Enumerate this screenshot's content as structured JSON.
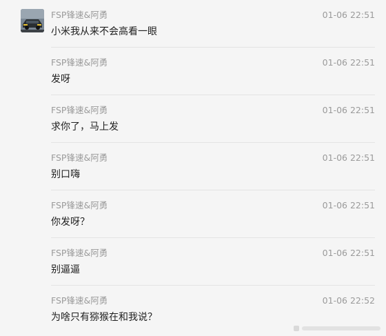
{
  "messages": [
    {
      "sender": "FSP锋速&阿勇",
      "time": "01-06 22:51",
      "text": "小米我从来不会高看一眼",
      "has_avatar": true
    },
    {
      "sender": "FSP锋速&阿勇",
      "time": "01-06 22:51",
      "text": "发呀",
      "has_avatar": false
    },
    {
      "sender": "FSP锋速&阿勇",
      "time": "01-06 22:51",
      "text": "求你了，马上发",
      "has_avatar": false
    },
    {
      "sender": "FSP锋速&阿勇",
      "time": "01-06 22:51",
      "text": "别口嗨",
      "has_avatar": false
    },
    {
      "sender": "FSP锋速&阿勇",
      "time": "01-06 22:51",
      "text": "你发呀？",
      "has_avatar": false
    },
    {
      "sender": "FSP锋速&阿勇",
      "time": "01-06 22:51",
      "text": "别逼逼",
      "has_avatar": false
    },
    {
      "sender": "FSP锋速&阿勇",
      "time": "01-06 22:52",
      "text": "为啥只有猕猴在和我说？",
      "has_avatar": false
    }
  ],
  "colors": {
    "background": "#f5f5f5",
    "meta_text": "#9a9a9a",
    "body_text": "#202020",
    "divider": "#e3e3e3"
  }
}
